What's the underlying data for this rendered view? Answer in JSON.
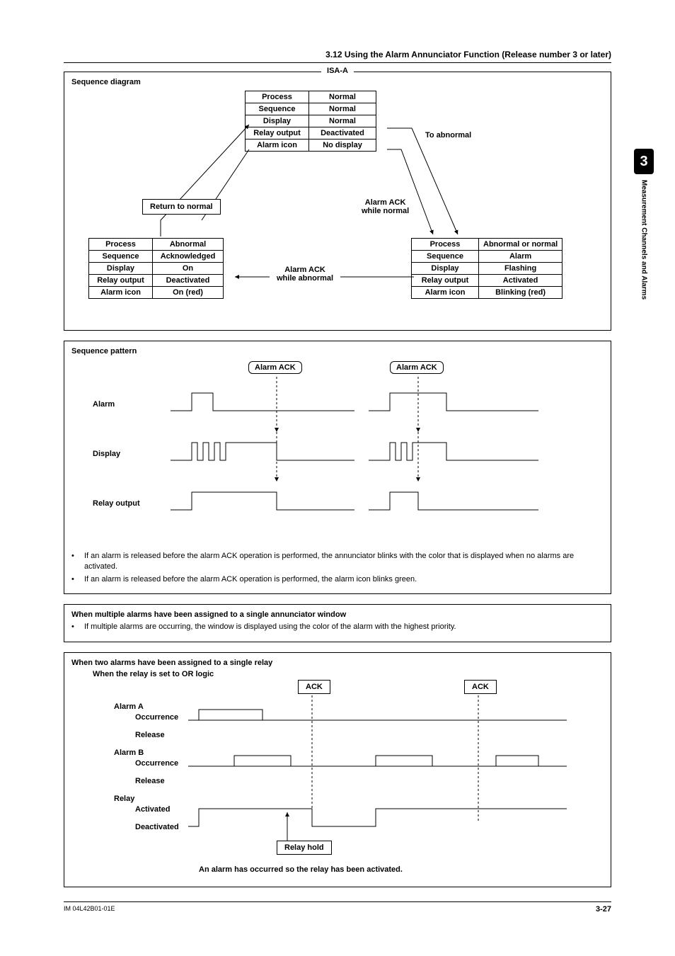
{
  "header": "3.12  Using the Alarm Annunciator Function (Release number 3 or later)",
  "sideTab": {
    "num": "3",
    "text": "Measurement Channels and Alarms"
  },
  "isa_title": "ISA-A",
  "sequence_diagram": {
    "title": "Sequence diagram",
    "normal": {
      "rows": [
        [
          "Process",
          "Normal"
        ],
        [
          "Sequence",
          "Normal"
        ],
        [
          "Display",
          "Normal"
        ],
        [
          "Relay output",
          "Deactivated"
        ],
        [
          "Alarm icon",
          "No display"
        ]
      ]
    },
    "abnormal": {
      "rows": [
        [
          "Process",
          "Abnormal"
        ],
        [
          "Sequence",
          "Acknowledged"
        ],
        [
          "Display",
          "On"
        ],
        [
          "Relay output",
          "Deactivated"
        ],
        [
          "Alarm icon",
          "On (red)"
        ]
      ]
    },
    "alarm": {
      "rows": [
        [
          "Process",
          "Abnormal or normal"
        ],
        [
          "Sequence",
          "Alarm"
        ],
        [
          "Display",
          "Flashing"
        ],
        [
          "Relay output",
          "Activated"
        ],
        [
          "Alarm icon",
          "Blinking (red)"
        ]
      ]
    },
    "return_label": "Return to normal",
    "to_abnormal": "To abnormal",
    "ack_normal": "Alarm ACK\nwhile normal",
    "ack_abnormal": "Alarm ACK\nwhile abnormal"
  },
  "sequence_pattern": {
    "title": "Sequence pattern",
    "ack": "Alarm ACK",
    "rows": [
      "Alarm",
      "Display",
      "Relay output"
    ]
  },
  "bullets": [
    "If an alarm is released before the alarm ACK operation is performed, the annunciator blinks with the color that is displayed when no alarms are activated.",
    "If an alarm is released before the alarm ACK operation is performed, the alarm icon blinks green."
  ],
  "multi_window": {
    "heading": "When multiple alarms have been assigned to a single annunciator window",
    "bullet": "If multiple alarms are occurring, the window is displayed using the color of the alarm with the highest priority."
  },
  "relay_section": {
    "heading": "When two alarms have been assigned to a single relay",
    "sub": "When the relay is set to OR logic",
    "ack": "ACK",
    "labels": {
      "alarmA": "Alarm A",
      "alarmB": "Alarm B",
      "occurrence": "Occurrence",
      "release": "Release",
      "relay": "Relay",
      "activated": "Activated",
      "deactivated": "Deactivated",
      "relay_hold": "Relay hold",
      "note": "An alarm has occurred so the relay has been activated."
    }
  },
  "footer": {
    "doc": "IM 04L42B01-01E",
    "page": "3-27"
  }
}
